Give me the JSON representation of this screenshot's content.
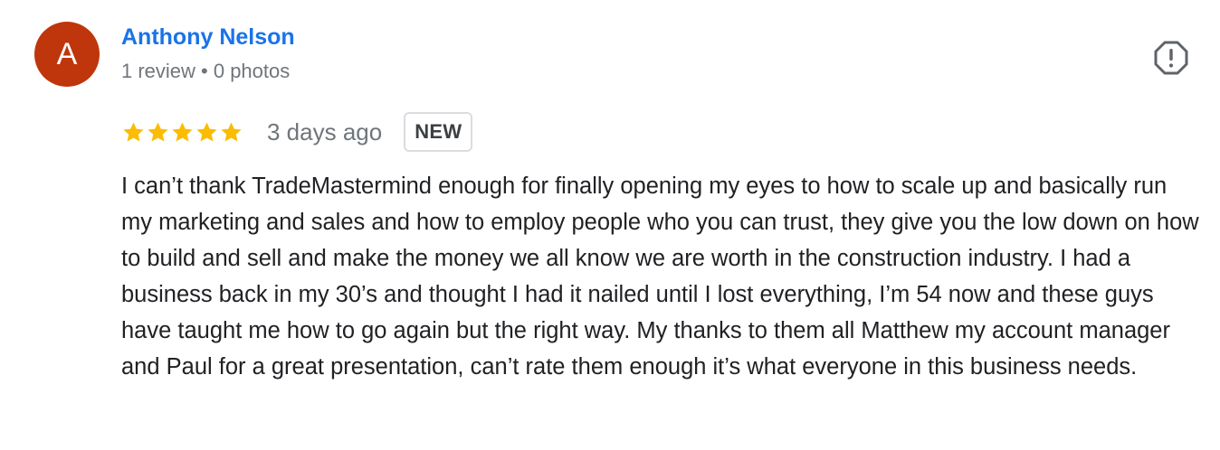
{
  "reviewer": {
    "avatar_letter": "A",
    "avatar_color": "#bf360c",
    "name": "Anthony Nelson",
    "meta": "1 review • 0 photos"
  },
  "actions": {
    "report_icon": "report-octagon-icon"
  },
  "review": {
    "rating": 5,
    "max_rating": 5,
    "star_color": "#fbbc04",
    "date": "3 days ago",
    "badge": "NEW",
    "text": "I can’t thank TradeMastermind enough for finally opening my eyes to how to scale up and basically run my marketing and sales and how to employ people who you can trust, they give you the low down on how to build and sell and make the money we all know we are worth in the construction industry. I had a business back in my 30’s and thought I had it nailed until I lost everything, I’m 54 now and these guys have taught me how to go again but the right way. My thanks to them all Matthew my account manager and Paul for a great presentation, can’t rate them enough it’s what everyone in this business needs."
  }
}
